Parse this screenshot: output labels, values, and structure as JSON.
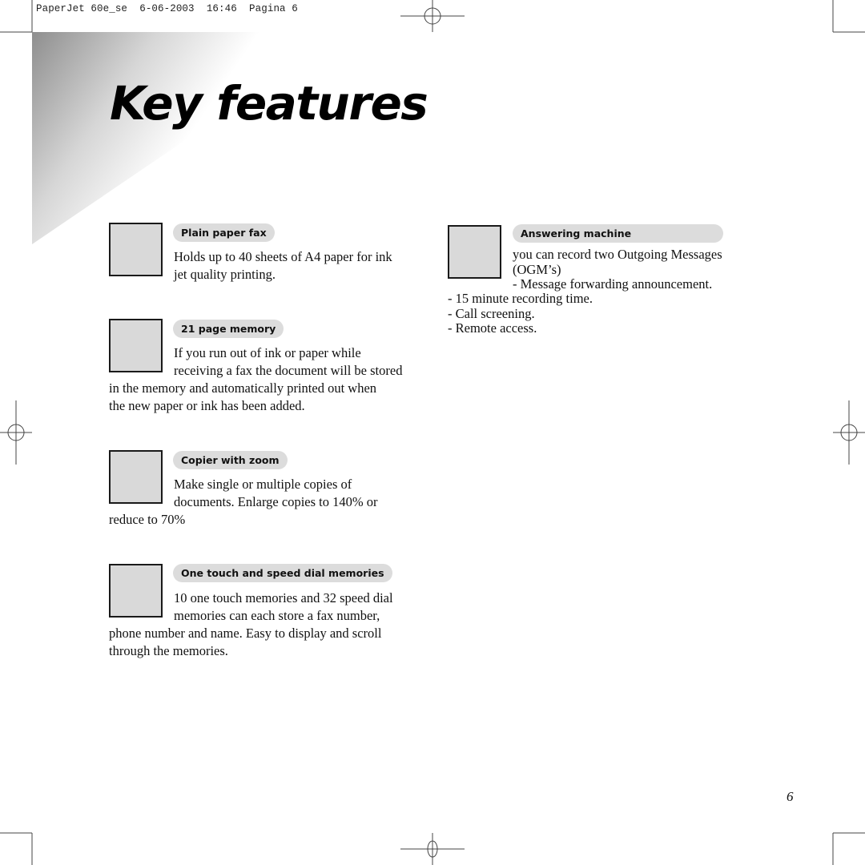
{
  "slug": {
    "text": "PaperJet 60e_se  6-06-2003  16:46  Pagina 6"
  },
  "page": {
    "title": "Key features",
    "page_number": "6"
  },
  "features": [
    {
      "heading": "Plain paper fax",
      "icon": "fax-icon-placeholder",
      "lines": [
        "Holds up to 40 sheets of A4 paper for ink",
        "jet quality printing."
      ]
    },
    {
      "heading": "21 page memory",
      "icon": "memory-icon-placeholder",
      "lines": [
        "If you run out of ink or paper while",
        "receiving a fax the document will be stored",
        "in the memory and automatically printed out when",
        "the new paper or ink has been added."
      ]
    },
    {
      "heading": "Copier with zoom",
      "icon": "copier-icon-placeholder",
      "lines": [
        "Make single or multiple copies of",
        "documents. Enlarge copies to 140% or",
        "reduce to 70%"
      ]
    },
    {
      "heading": "One touch and speed dial memories",
      "icon": "speed-dial-icon-placeholder",
      "lines": [
        "10 one touch memories and 32 speed dial",
        "memories can each store a fax number,",
        "phone number and name. Easy to display and scroll",
        "through the memories."
      ]
    },
    {
      "heading": "Answering machine",
      "icon": "answering-machine-icon-placeholder",
      "lines": [
        "you can record two Outgoing Messages",
        "(OGM’s)",
        "- Message forwarding announcement.",
        "- 15 minute recording time.",
        "- Call screening.",
        "- Remote access."
      ]
    }
  ]
}
